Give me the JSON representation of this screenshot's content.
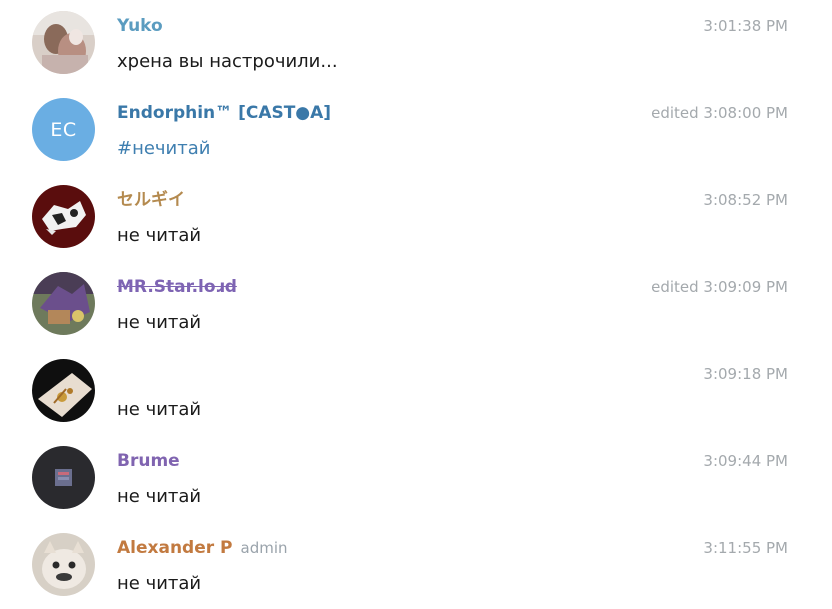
{
  "messages": [
    {
      "sender": "Yuko",
      "sender_color": "#5b9cc0",
      "time": "3:01:38 PM",
      "text": "хрена вы настрочили...",
      "avatar": "photo"
    },
    {
      "sender": "Endorphin™ [CAST●A]",
      "sender_color": "#3a78a8",
      "time": "edited 3:08:00 PM",
      "text": "#нечитай",
      "text_color": "#3f7fb0",
      "avatar": "initials",
      "avatar_initials": "EC",
      "avatar_color": "#6aaee3"
    },
    {
      "sender": "セルギイ",
      "sender_color": "#b48a4f",
      "time": "3:08:52 PM",
      "text": "не читай",
      "avatar": "photo"
    },
    {
      "sender": "MR.Star.loɹd",
      "sender_color": "#7e64b3",
      "time": "edited 3:09:09 PM",
      "text": "не читай",
      "avatar": "photo"
    },
    {
      "sender": "",
      "time": "3:09:18 PM",
      "text": "не читай",
      "avatar": "photo"
    },
    {
      "sender": "Brume",
      "sender_color": "#8064b0",
      "time": "3:09:44 PM",
      "text": "не читай",
      "avatar": "photo"
    },
    {
      "sender": "Alexander P",
      "sender_color": "#c27a40",
      "badge": "admin",
      "time": "3:11:55 PM",
      "text": "не читай",
      "avatar": "photo"
    }
  ]
}
